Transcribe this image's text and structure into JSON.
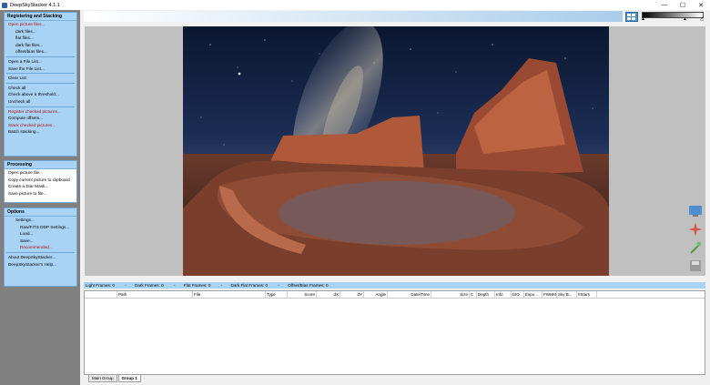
{
  "window": {
    "title": "DeepSkyStacker 4.1.1",
    "minimize": "—",
    "maximize": "☐",
    "close": "✕"
  },
  "sidebar": {
    "registering": {
      "header": "Registering and Stacking",
      "items": [
        "Open picture files...",
        "dark files...",
        "flat files...",
        "dark flat files...",
        "offset/bias files...",
        "Open a File List...",
        "Save the File List...",
        "Clear List",
        "Check all",
        "Check above a threshold...",
        "Uncheck all",
        "Register checked pictures...",
        "Compute offsets...",
        "Stack checked pictures...",
        "Batch stacking..."
      ]
    },
    "processing": {
      "header": "Processing",
      "items": [
        "Open picture file...",
        "Copy current picture to clipboard",
        "Create a Star Mask...",
        "Save picture to file..."
      ]
    },
    "options": {
      "header": "Options",
      "items": [
        "Settings...",
        "Raw/FITS DDP Settings...",
        "Load...",
        "Save...",
        "Recommended...",
        "About DeepSkyStacker...",
        "DeepSkyStacker's Help..."
      ]
    }
  },
  "stats": {
    "light": "Light Frames: 0",
    "dark": "Dark Frames: 0",
    "flat": "Flat Frames: 0",
    "darkflat": "Dark Flat Frames: 0",
    "offset": "Offset/Bias Frames: 0",
    "sep": "-"
  },
  "table": {
    "columns": [
      "",
      "Path",
      "File",
      "Type",
      "Score",
      "dX",
      "dY",
      "Angle",
      "Date/Time",
      "Size",
      "C",
      "Depth",
      "Info",
      "ISO",
      "Expo...",
      "FWHM",
      "Sky B...",
      "#Stars"
    ]
  },
  "tabs": [
    "Main Group",
    "Group 1"
  ],
  "colors": {
    "panel": "#a9d3f5",
    "sidebar": "#808080",
    "accent_red": "#b01010"
  }
}
